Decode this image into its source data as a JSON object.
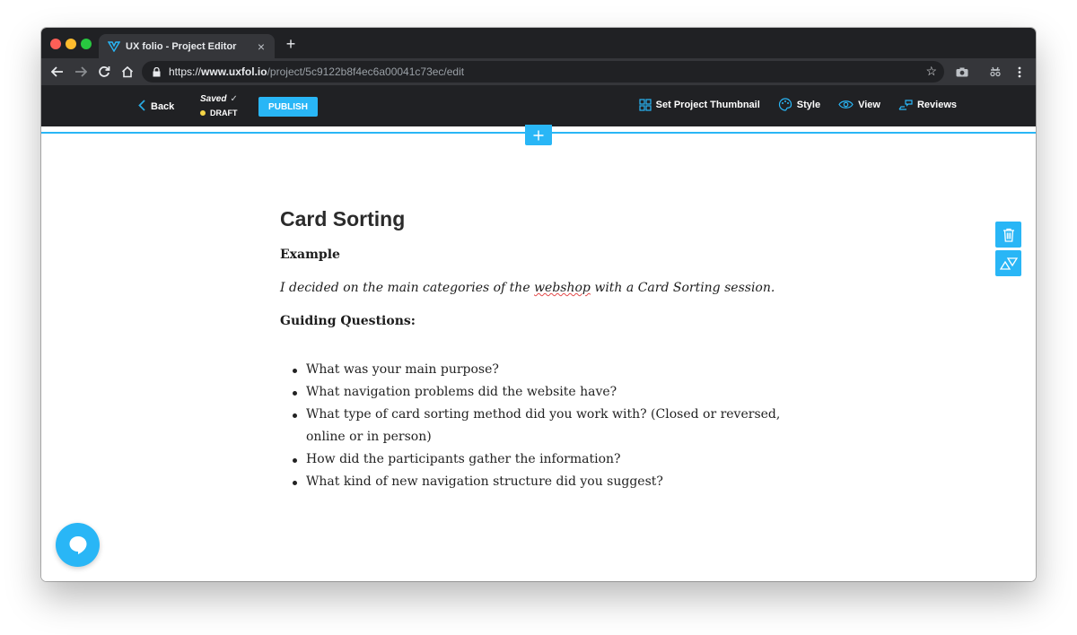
{
  "browser": {
    "tab_title": "UX folio - Project Editor",
    "tab_close": "×",
    "new_tab": "+",
    "url_scheme": "https://",
    "url_host": "www.uxfol.io",
    "url_path": "/project/5c9122b8f4ec6a00041c73ec/edit"
  },
  "appbar": {
    "back_label": "Back",
    "saved_label": "Saved",
    "status_label": "DRAFT",
    "publish_label": "PUBLISH",
    "actions": {
      "thumbnail": "Set Project Thumbnail",
      "style": "Style",
      "view": "View",
      "reviews": "Reviews"
    }
  },
  "content": {
    "title": "Card Sorting",
    "subtitle": "Example",
    "intro_before": "I decided on the main categories of the ",
    "intro_misspelled": "webshop",
    "intro_after": " with a Card Sorting session.",
    "guiding_heading": "Guiding Questions:",
    "questions": [
      "What was your main purpose?",
      "What navigation problems did the website have?",
      "What type of card sorting method did you work with? (Closed or reversed, online or in person)",
      "How did the participants gather the information?",
      "What kind of new navigation structure did you suggest?"
    ]
  },
  "colors": {
    "accent": "#29b6f6",
    "chrome_dark": "#202124",
    "draft_dot": "#f5d547"
  }
}
